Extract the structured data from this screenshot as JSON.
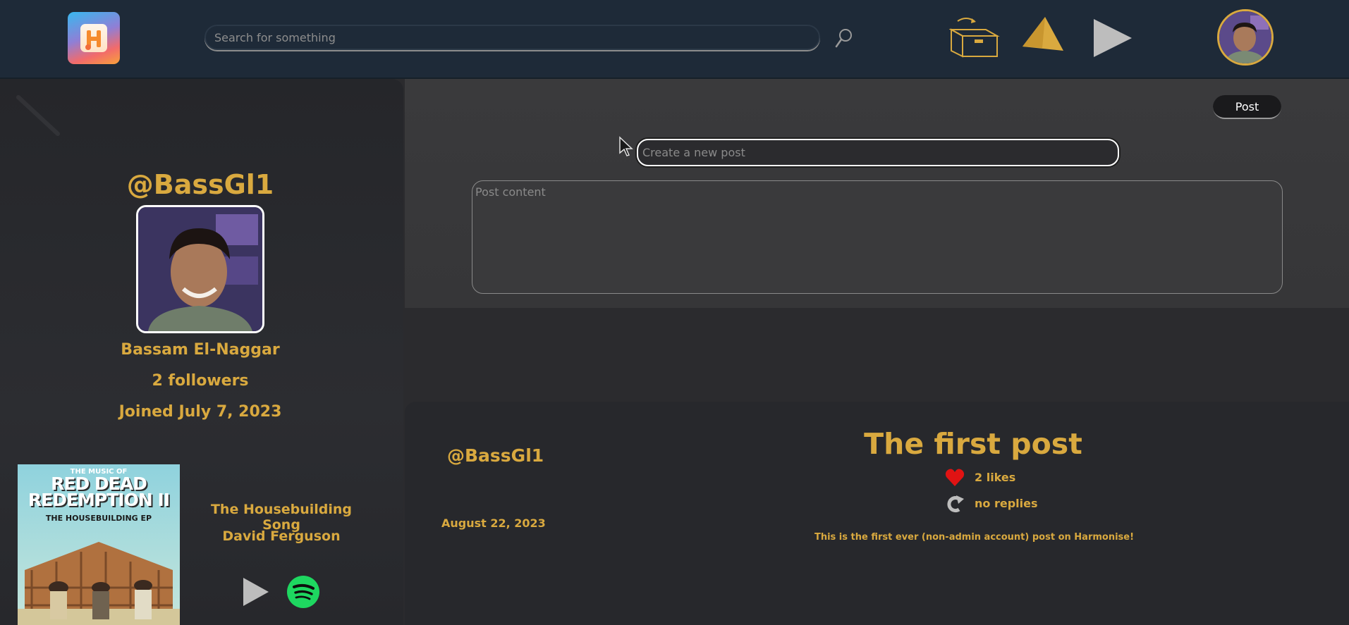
{
  "header": {
    "search": {
      "placeholder": "Search for something",
      "value": ""
    },
    "logo_icon": "harmonise-logo",
    "nav_icons": [
      "open-box-icon",
      "paper-plane-icon",
      "play-icon"
    ],
    "avatar_icon": "user-avatar"
  },
  "colors": {
    "accent": "#d9a93f",
    "topbar": "#1e2a38",
    "background": "#2b2b2e"
  },
  "profile": {
    "username": "@BassGl1",
    "name": "Bassam El-Naggar",
    "followers": "2 followers",
    "joined": "Joined July 7, 2023"
  },
  "now_playing": {
    "album_line1": "THE MUSIC OF",
    "album_line2": "RED DEAD REDEMPTION II",
    "album_line3": "THE HOUSEBUILDING EP",
    "song": "The Housebuilding Song",
    "artist": "David Ferguson",
    "controls": [
      "play-icon",
      "spotify-icon"
    ]
  },
  "composer": {
    "post_label": "Post",
    "title_placeholder": "Create a new post",
    "content_placeholder": "Post content"
  },
  "post": {
    "username": "@BassGl1",
    "date": "August 22, 2023",
    "title": "The first post",
    "likes": "2 likes",
    "replies": "no replies",
    "body": "This is the first ever (non-admin account) post on Harmonise!"
  }
}
